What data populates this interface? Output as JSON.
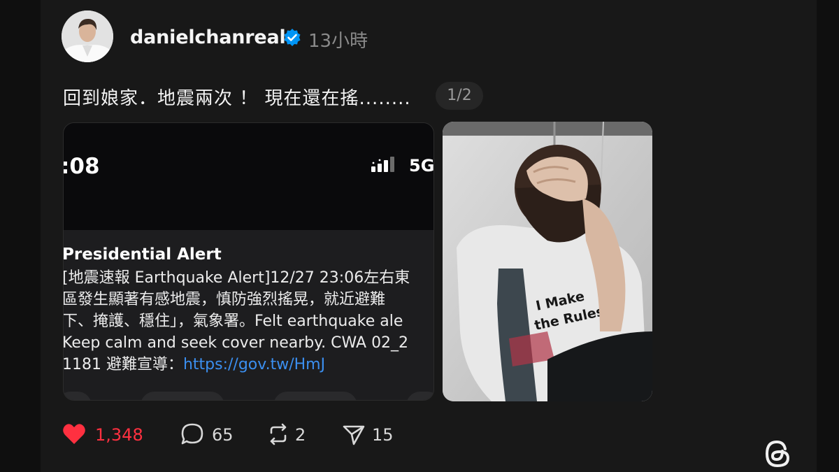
{
  "post": {
    "username": "danielchanreal",
    "time": "13小時",
    "caption": "回到娘家．地震兩次 ！ 現在還在搖........",
    "pager": "1/2"
  },
  "screenshot": {
    "clock": ":08",
    "network": "5G",
    "alert_title": "Presidential Alert",
    "alert_lines": [
      "[地震速報 Earthquake Alert]12/27 23:06左右東",
      "區發生顯著有感地震，慎防強烈搖晃，就近避難",
      "下、掩護、穩住」，氣象署。Felt earthquake ale",
      "Keep calm and seek cover nearby. CWA 02_2",
      "1181 避難宣導："
    ],
    "alert_link": "https://gov.tw/HmJ"
  },
  "photo": {
    "shirt_text_1": "I Make",
    "shirt_text_2": "the Rules"
  },
  "actions": {
    "likes": "1,348",
    "comments": "65",
    "reposts": "2",
    "shares": "15"
  },
  "colors": {
    "like": "#ff3040",
    "verified": "#0095f6",
    "link": "#3b8ff0"
  },
  "icons": [
    "verified-badge-icon",
    "heart-icon",
    "comment-icon",
    "repost-icon",
    "share-icon",
    "threads-logo-icon"
  ]
}
